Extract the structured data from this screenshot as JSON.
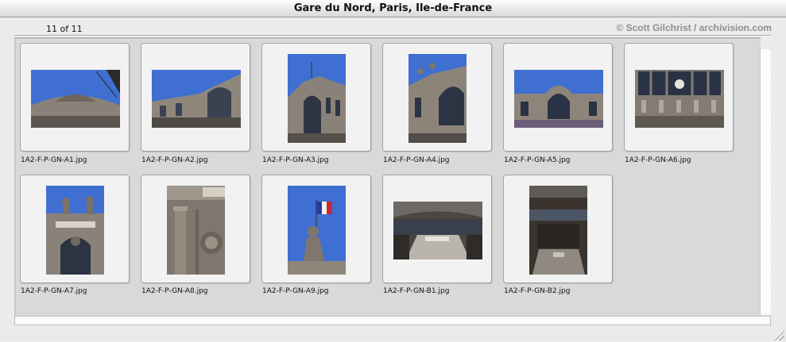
{
  "window": {
    "title": "Gare du Nord, Paris, Ile-de-France"
  },
  "header": {
    "count": "11 of 11",
    "credit": "© Scott Gilchrist / archivision.com"
  },
  "thumbnails": [
    {
      "filename": "1A2-F-P-GN-A1.jpg"
    },
    {
      "filename": "1A2-F-P-GN-A2.jpg"
    },
    {
      "filename": "1A2-F-P-GN-A3.jpg"
    },
    {
      "filename": "1A2-F-P-GN-A4.jpg"
    },
    {
      "filename": "1A2-F-P-GN-A5.jpg"
    },
    {
      "filename": "1A2-F-P-GN-A6.jpg"
    },
    {
      "filename": "1A2-F-P-GN-A7.jpg"
    },
    {
      "filename": "1A2-F-P-GN-A8.jpg"
    },
    {
      "filename": "1A2-F-P-GN-A9.jpg"
    },
    {
      "filename": "1A2-F-P-GN-B1.jpg"
    },
    {
      "filename": "1A2-F-P-GN-B2.jpg"
    }
  ],
  "colors": {
    "sky": "#3f6fd0",
    "stone": "#8a8278",
    "window": "#2a3448",
    "background": "#d9d9d9"
  }
}
